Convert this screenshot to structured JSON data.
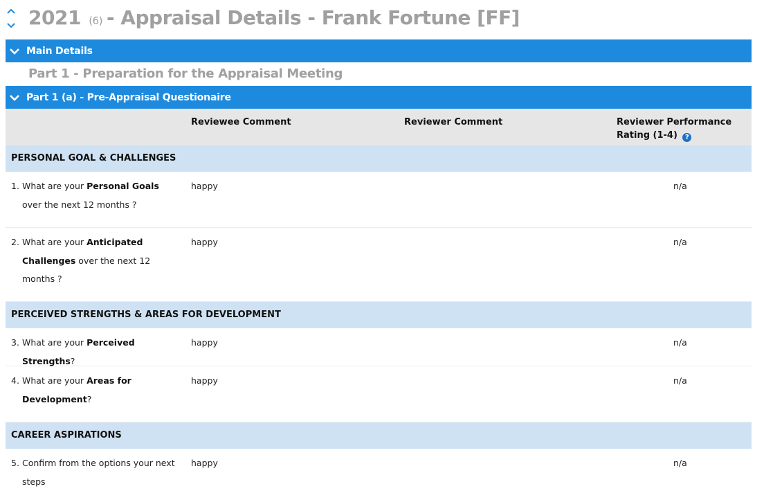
{
  "header": {
    "year": "2021",
    "count": "(6)",
    "title": "- Appraisal Details - Frank Fortune [FF]"
  },
  "sections": {
    "main_details": "Main Details",
    "part1_heading": "Part 1 - Preparation for the Appraisal Meeting",
    "part1a": "Part 1 (a) - Pre-Appraisal Questionaire"
  },
  "table": {
    "columns": {
      "reviewee": "Reviewee Comment",
      "reviewer": "Reviewer Comment",
      "rating_line1": "Reviewer Performance",
      "rating_line2": "Rating (1-4)",
      "help_glyph": "?"
    },
    "groups": {
      "g1": "PERSONAL GOAL & CHALLENGES",
      "g2": "PERCEIVED STRENGTHS & AREAS FOR DEVELOPMENT",
      "g3": "CAREER ASPIRATIONS"
    },
    "questions": {
      "q1": {
        "num": "1.",
        "pre": "What are your ",
        "bold": "Personal Goals",
        "post": " over the next 12 months ?",
        "reviewee": "happy",
        "rating": "n/a"
      },
      "q2": {
        "num": "2.",
        "pre": "What are your ",
        "bold": "Anticipated Challenges",
        "post": " over the next 12 months ?",
        "reviewee": "happy",
        "rating": "n/a"
      },
      "q3": {
        "num": "3.",
        "pre": "What are your ",
        "bold": "Perceived Strengths",
        "post": "?",
        "reviewee": "happy",
        "rating": "n/a"
      },
      "q4": {
        "num": "4.",
        "pre": "What are your ",
        "bold": "Areas for Development",
        "post": "?",
        "reviewee": "happy",
        "rating": "n/a"
      },
      "q5": {
        "num": "5.",
        "pre": "Confirm from the options your next steps",
        "bold": "",
        "post": "",
        "reviewee": "happy",
        "rating": "n/a"
      }
    }
  },
  "icons": {
    "nav": "chevron-up-down-icon",
    "section_toggle": "chevron-down-icon",
    "help": "help-icon"
  },
  "colors": {
    "section_bar": "#1e8ade",
    "group_row": "#cfe2f3",
    "table_header": "#e6e6e6",
    "title_gray": "#a0a0a0"
  }
}
